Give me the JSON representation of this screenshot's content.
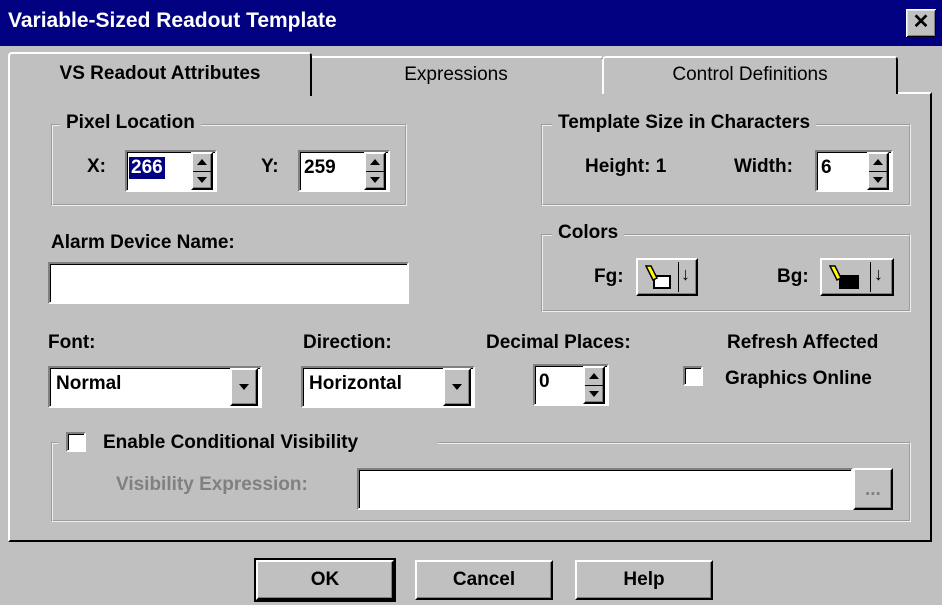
{
  "window": {
    "title": "Variable-Sized Readout Template",
    "close_glyph": "✕"
  },
  "tabs": [
    {
      "label": "VS Readout Attributes",
      "active": true
    },
    {
      "label": "Expressions",
      "active": false
    },
    {
      "label": "Control Definitions",
      "active": false
    }
  ],
  "pixel_location": {
    "legend": "Pixel Location",
    "x_label": "X:",
    "x_value": "266",
    "y_label": "Y:",
    "y_value": "259"
  },
  "template_size": {
    "legend": "Template Size in Characters",
    "height_text": "Height: 1",
    "width_label": "Width:",
    "width_value": "6"
  },
  "alarm": {
    "label": "Alarm Device Name:",
    "value": ""
  },
  "colors": {
    "legend": "Colors",
    "fg_label": "Fg:",
    "bg_label": "Bg:",
    "fg_fill": "#ffffff",
    "bg_fill": "#000000",
    "pencil_color": "#ffff00",
    "dropdown_glyph": "↓"
  },
  "font": {
    "label": "Font:",
    "value": "Normal"
  },
  "direction": {
    "label": "Direction:",
    "value": "Horizontal"
  },
  "decimal": {
    "label": "Decimal Places:",
    "value": "0"
  },
  "refresh": {
    "line1": "Refresh Affected",
    "line2": "Graphics Online",
    "checked": false
  },
  "visibility": {
    "enable_label": "Enable Conditional Visibility",
    "checked": false,
    "expr_label": "Visibility Expression:",
    "expr_value": "",
    "browse_label": "..."
  },
  "buttons": {
    "ok": "OK",
    "cancel": "Cancel",
    "help": "Help"
  },
  "theme": {
    "title_bar": "#000080",
    "face": "#c0c0c0",
    "selection": "#000080"
  }
}
